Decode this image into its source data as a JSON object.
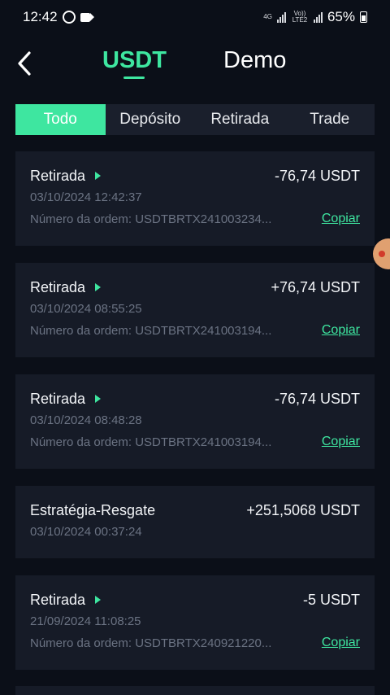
{
  "status_bar": {
    "time": "12:42",
    "net_1": "4G",
    "net_2": "Vo)) LTE2",
    "battery": "65%"
  },
  "header": {
    "tab_usdt": "USDT",
    "tab_demo": "Demo"
  },
  "filters": [
    "Todo",
    "Depósito",
    "Retirada",
    "Trade"
  ],
  "transactions": [
    {
      "type": "Retirada",
      "amount": "-76,74 USDT",
      "date": "03/10/2024 12:42:37",
      "order": "Número da ordem: USDTBRTX241003234...",
      "copy": "Copiar"
    },
    {
      "type": "Retirada",
      "amount": "+76,74 USDT",
      "date": "03/10/2024 08:55:25",
      "order": "Número da ordem: USDTBRTX241003194...",
      "copy": "Copiar"
    },
    {
      "type": "Retirada",
      "amount": "-76,74 USDT",
      "date": "03/10/2024 08:48:28",
      "order": "Número da ordem: USDTBRTX241003194...",
      "copy": "Copiar"
    },
    {
      "type": "Estratégia-Resgate",
      "amount": "+251,5068 USDT",
      "date": "03/10/2024 00:37:24"
    },
    {
      "type": "Retirada",
      "amount": "-5 USDT",
      "date": "21/09/2024 11:08:25",
      "order": "Número da ordem: USDTBRTX240921220...",
      "copy": "Copiar"
    }
  ]
}
